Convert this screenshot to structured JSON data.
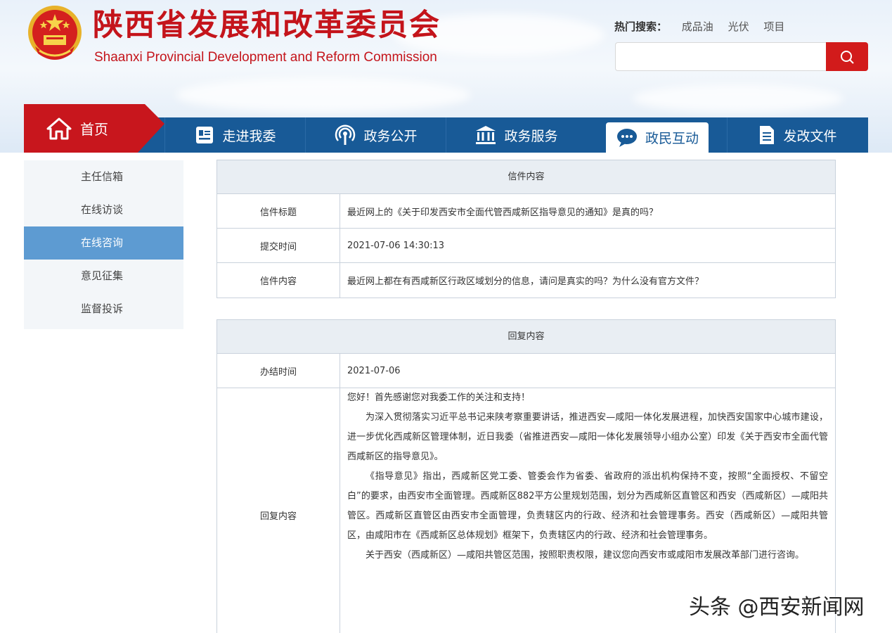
{
  "header": {
    "title": "陕西省发展和改革委员会",
    "subtitle": "Shaanxi Provincial Development and Reform Commission",
    "hot_search_label": "热门搜索：",
    "hot_keywords": [
      "成品油",
      "光伏",
      "项目"
    ],
    "search_placeholder": "",
    "brand_red": "#c4141b",
    "nav_blue": "#185a97"
  },
  "nav": {
    "home": {
      "label": "首页",
      "icon": "home-icon"
    },
    "items": [
      {
        "label": "走进我委",
        "icon": "id-card-icon"
      },
      {
        "label": "政务公开",
        "icon": "broadcast-icon"
      },
      {
        "label": "政务服务",
        "icon": "building-icon"
      },
      {
        "label": "政民互动",
        "icon": "chat-bubble-icon",
        "active": true
      },
      {
        "label": "发改文件",
        "icon": "document-icon"
      }
    ]
  },
  "sidebar": {
    "items": [
      {
        "label": "主任信箱"
      },
      {
        "label": "在线访谈"
      },
      {
        "label": "在线咨询",
        "active": true
      },
      {
        "label": "意见征集"
      },
      {
        "label": "监督投诉"
      }
    ]
  },
  "letter": {
    "heading": "信件内容",
    "title_label": "信件标题",
    "title_value": "最近网上的《关于印发西安市全面代管西咸新区指导意见的通知》是真的吗？",
    "time_label": "提交时间",
    "time_value": "2021-07-06 14:30:13",
    "content_label": "信件内容",
    "content_value": "最近网上都在有西咸新区行政区域划分的信息，请问是真实的吗？为什么没有官方文件？"
  },
  "reply": {
    "heading": "回复内容",
    "date_label": "办结时间",
    "date_value": "2021-07-06",
    "content_label": "回复内容",
    "paragraphs": [
      "您好！首先感谢您对我委工作的关注和支持！",
      "为深入贯彻落实习近平总书记来陕考察重要讲话，推进西安—咸阳一体化发展进程，加快西安国家中心城市建设，进一步优化西咸新区管理体制，近日我委（省推进西安—咸阳一体化发展领导小组办公室）印发《关于西安市全面代管西咸新区的指导意见》。",
      "《指导意见》指出，西咸新区党工委、管委会作为省委、省政府的派出机构保持不变，按照“全面授权、不留空白”的要求，由西安市全面管理。西咸新区882平方公里规划范围，划分为西咸新区直管区和西安（西咸新区）—咸阳共管区。西咸新区直管区由西安市全面管理，负责辖区内的行政、经济和社会管理事务。西安（西咸新区）—咸阳共管区，由咸阳市在《西咸新区总体规划》框架下，负责辖区内的行政、经济和社会管理事务。",
      "关于西安（西咸新区）—咸阳共管区范围，按照职责权限，建议您向西安市或咸阳市发展改革部门进行咨询。"
    ]
  },
  "watermark": "头条 @西安新闻网"
}
